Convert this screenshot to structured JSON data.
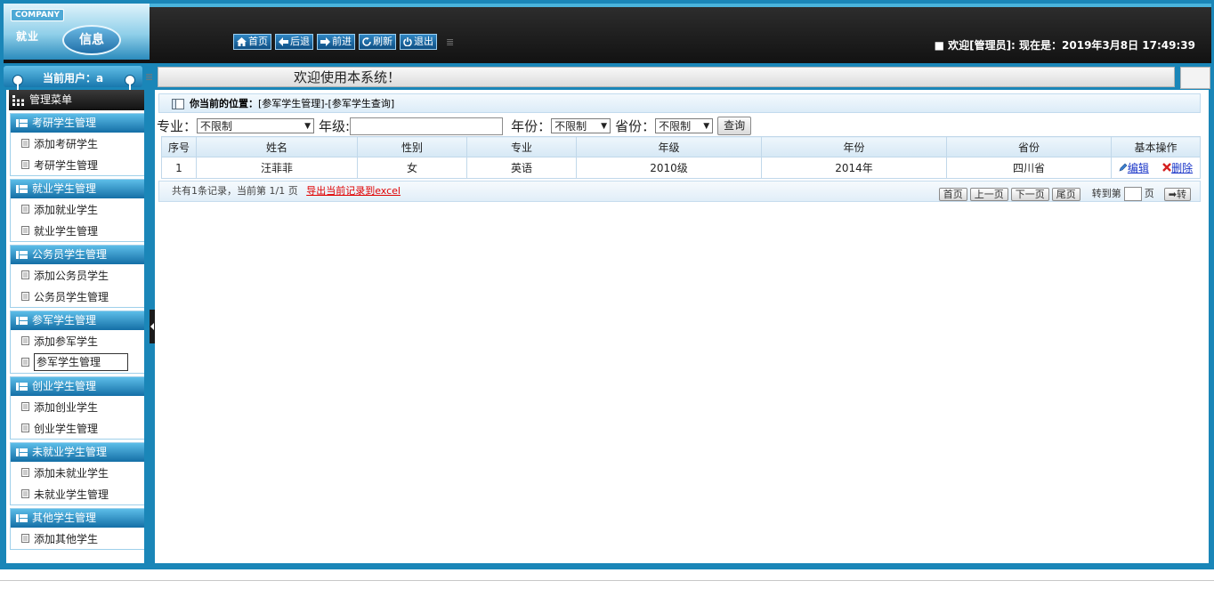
{
  "header": {
    "company": "COMPANY",
    "logo_text": "就业",
    "logo_oval": "信息",
    "welcome": "■ 欢迎[管理员]:  现在是：2019年3月8日 17:49:39"
  },
  "toolbar": {
    "home": "首页",
    "back": "后退",
    "forward": "前进",
    "refresh": "刷新",
    "logout": "退出"
  },
  "userbar": {
    "label": "当前用户：a"
  },
  "titlebar": {
    "text": "欢迎使用本系统！"
  },
  "sidebar": {
    "title": "管理菜单",
    "groups": [
      {
        "title": "考研学生管理",
        "items": [
          "添加考研学生",
          "考研学生管理"
        ]
      },
      {
        "title": "就业学生管理",
        "items": [
          "添加就业学生",
          "就业学生管理"
        ]
      },
      {
        "title": "公务员学生管理",
        "items": [
          "添加公务员学生",
          "公务员学生管理"
        ]
      },
      {
        "title": "参军学生管理",
        "items": [
          "添加参军学生",
          "参军学生管理"
        ]
      },
      {
        "title": "创业学生管理",
        "items": [
          "添加创业学生",
          "创业学生管理"
        ]
      },
      {
        "title": "未就业学生管理",
        "items": [
          "添加未就业学生",
          "未就业学生管理"
        ]
      },
      {
        "title": "其他学生管理",
        "items": [
          "添加其他学生"
        ]
      }
    ]
  },
  "breadcrumb": {
    "prefix": "你当前的位置：",
    "path": "[参军学生管理]-[参军学生查询]"
  },
  "filters": {
    "major_label": "专业：",
    "major_value": "不限制",
    "grade_label": "年级:",
    "grade_value": "",
    "year_label": "年份：",
    "year_value": "不限制",
    "province_label": "省份：",
    "province_value": "不限制",
    "query_button": "查询"
  },
  "table": {
    "columns": [
      "序号",
      "姓名",
      "性别",
      "专业",
      "年级",
      "年份",
      "省份",
      "基本操作"
    ],
    "rows": [
      [
        "1",
        "汪菲菲",
        "女",
        "英语",
        "2010级",
        "2014年",
        "四川省"
      ]
    ],
    "edit_label": "编辑",
    "delete_label": "删除"
  },
  "pager": {
    "summary": "共有1条记录，当前第 1/1 页",
    "export": "导出当前记录到excel",
    "first": "首页",
    "prev": "上一页",
    "next": "下一页",
    "last": "尾页",
    "goto_label": "转到第",
    "page_unit": "页",
    "go": "➡转"
  }
}
